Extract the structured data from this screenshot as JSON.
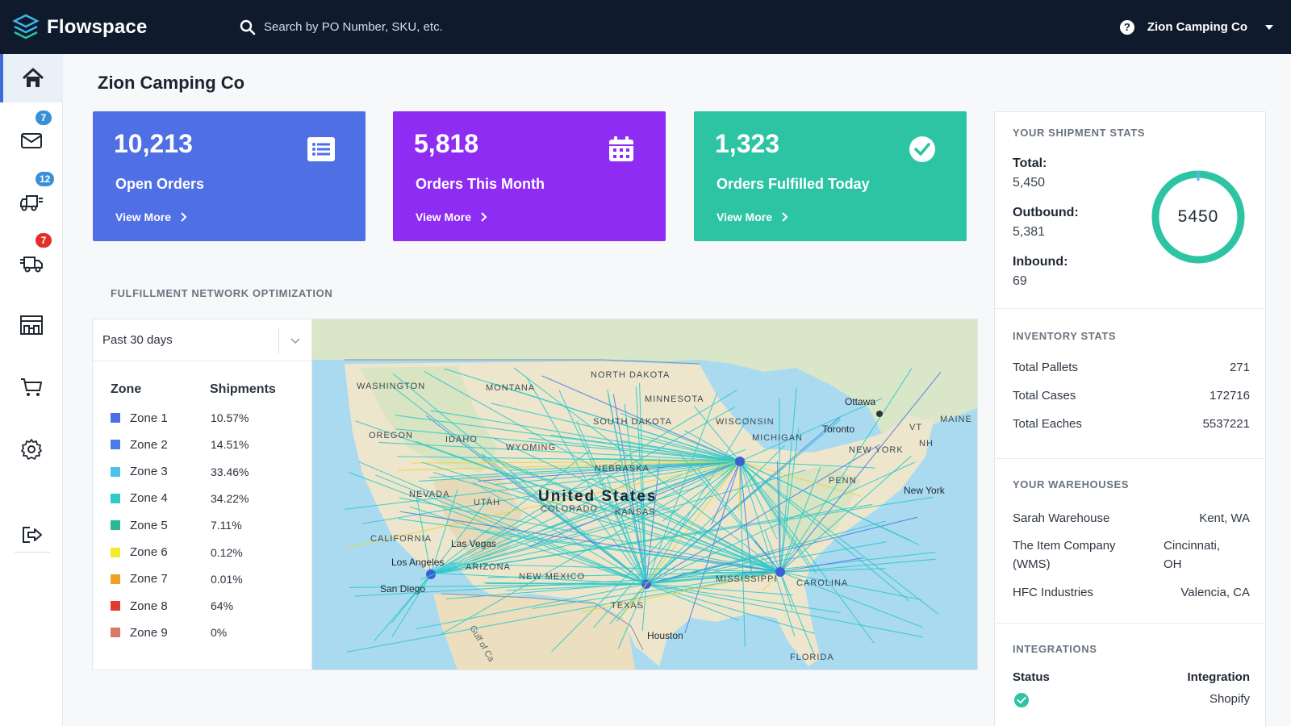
{
  "header": {
    "brand": "Flowspace",
    "search_placeholder": "Search by PO Number, SKU, etc.",
    "account": "Zion Camping Co"
  },
  "sidebar": {
    "items": [
      {
        "name": "home",
        "badge": ""
      },
      {
        "name": "inbox",
        "badge": "7"
      },
      {
        "name": "inbound",
        "badge": "12"
      },
      {
        "name": "outbound",
        "badge": "7"
      },
      {
        "name": "warehouse",
        "badge": ""
      },
      {
        "name": "cart",
        "badge": ""
      },
      {
        "name": "settings",
        "badge": ""
      },
      {
        "name": "logout",
        "badge": ""
      }
    ]
  },
  "page": {
    "title": "Zion Camping Co"
  },
  "cards": [
    {
      "value": "10,213",
      "label": "Open Orders",
      "link": "View More",
      "color": "#4f6fe4",
      "icon": "list-icon"
    },
    {
      "value": "5,818",
      "label": "Orders This Month",
      "link": "View More",
      "color": "#8e2cf4",
      "icon": "calendar-icon"
    },
    {
      "value": "1,323",
      "label": "Orders Fulfilled Today",
      "link": "View More",
      "color": "#2dc4a3",
      "icon": "check-circle-icon"
    }
  ],
  "network": {
    "title": "FULFILLMENT NETWORK OPTIMIZATION",
    "period": "Past 30 days",
    "zone_header": "Zone",
    "shipments_header": "Shipments",
    "zones": [
      {
        "name": "Zone 1",
        "value": "10.57%",
        "color": "#4a6fe3"
      },
      {
        "name": "Zone 2",
        "value": "14.51%",
        "color": "#4b7de8"
      },
      {
        "name": "Zone 3",
        "value": "33.46%",
        "color": "#4cc3e6"
      },
      {
        "name": "Zone 4",
        "value": "34.22%",
        "color": "#2ec9c9"
      },
      {
        "name": "Zone 5",
        "value": "7.11%",
        "color": "#2bb893"
      },
      {
        "name": "Zone 6",
        "value": "0.12%",
        "color": "#f2ea2c"
      },
      {
        "name": "Zone 7",
        "value": "0.01%",
        "color": "#f0a02a"
      },
      {
        "name": "Zone 8",
        "value": "64%",
        "color": "#e33a2f"
      },
      {
        "name": "Zone 9",
        "value": "0%",
        "color": "#d97867"
      }
    ],
    "map_labels": {
      "washington": "WASHINGTON",
      "montana": "MONTANA",
      "north_dakota": "NORTH DAKOTA",
      "oregon": "OREGON",
      "idaho": "IDAHO",
      "wyoming": "WYOMING",
      "south_dakota": "SOUTH DAKOTA",
      "nevada": "NEVADA",
      "utah": "UTAH",
      "nebraska": "NEBRASKA",
      "california": "CALIFORNIA",
      "arizona": "ARIZONA",
      "new_mexico": "NEW MEXICO",
      "texas": "TEXAS",
      "michigan": "MICHIGAN",
      "minnesota": "MINNESOTA",
      "wisconsin": "WISCONSIN",
      "kansas": "KANSAS",
      "mississippi": "MISSISSIPPI",
      "florida": "FLORIDA",
      "carolina": "CAROLINA",
      "new_york_state": "NEW YORK",
      "penn": "PENN",
      "maine": "MAINE",
      "vt": "VT",
      "nh": "NH",
      "colorado": "COLORADO",
      "country": "United States",
      "ottawa": "Ottawa",
      "toronto": "Toronto",
      "new_york": "New York",
      "las_vegas": "Las Vegas",
      "los_angeles": "Los Angeles",
      "san_diego": "San Diego",
      "houston": "Houston",
      "gulf": "Gulf of Ca"
    }
  },
  "shipment_stats": {
    "title": "YOUR SHIPMENT STATS",
    "total_label": "Total:",
    "total": "5,450",
    "outbound_label": "Outbound:",
    "outbound": "5,381",
    "inbound_label": "Inbound:",
    "inbound": "69",
    "ring_value": "5450",
    "ring_color": "#2dc4a3"
  },
  "inventory_stats": {
    "title": "INVENTORY STATS",
    "rows": [
      {
        "label": "Total Pallets",
        "value": "271"
      },
      {
        "label": "Total Cases",
        "value": "172716"
      },
      {
        "label": "Total Eaches",
        "value": "5537221"
      }
    ]
  },
  "warehouses": {
    "title": "YOUR WAREHOUSES",
    "rows": [
      {
        "name": "Sarah Warehouse",
        "location": "Kent, WA"
      },
      {
        "name": "The Item Company (WMS)",
        "location": "Cincinnati, OH"
      },
      {
        "name": "HFC Industries",
        "location": "Valencia, CA"
      }
    ]
  },
  "integrations": {
    "title": "INTEGRATIONS",
    "status_header": "Status",
    "integration_header": "Integration",
    "rows": [
      {
        "status": "connected",
        "name": "Shopify"
      }
    ]
  }
}
